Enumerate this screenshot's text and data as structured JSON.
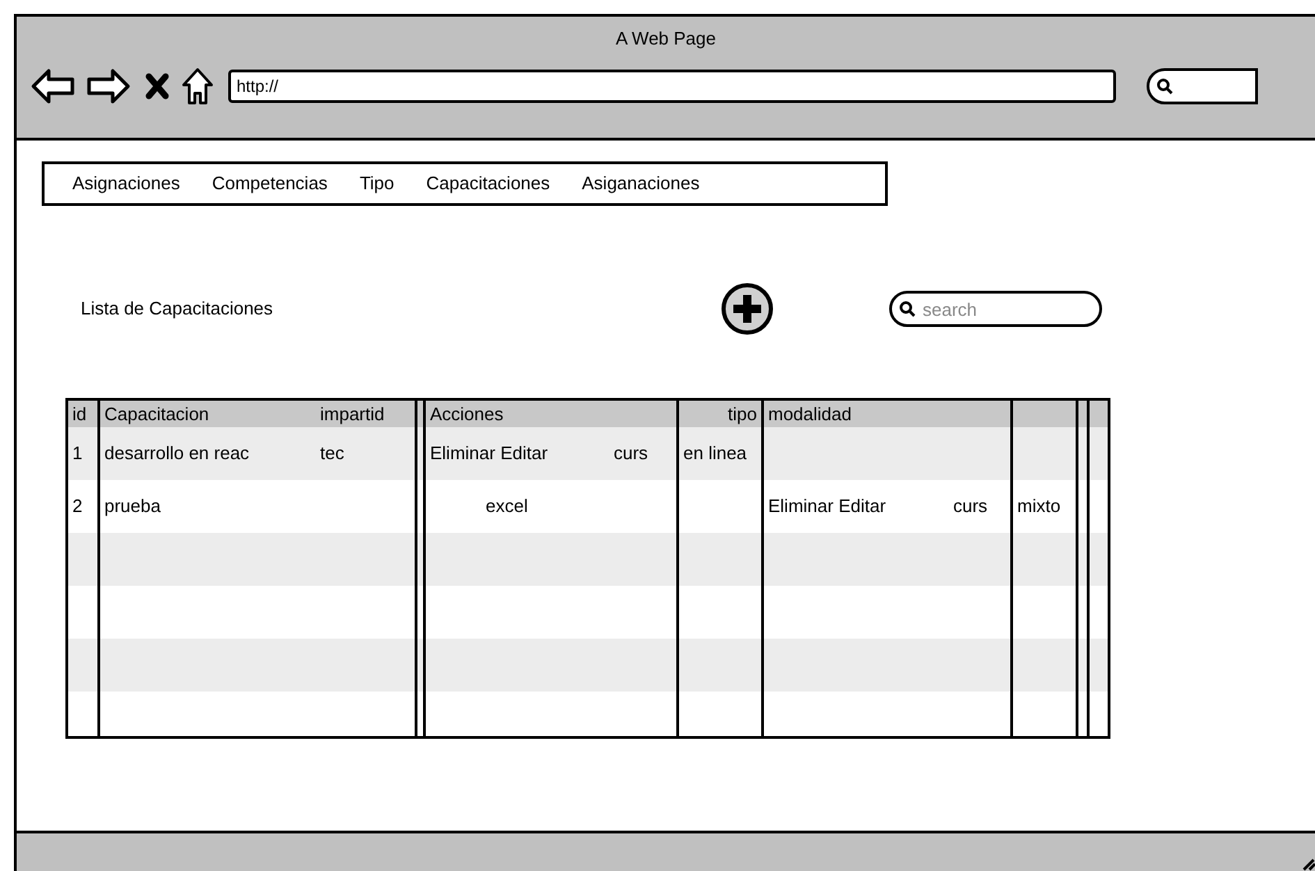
{
  "window": {
    "title": "A Web Page",
    "address": "http://"
  },
  "nav": {
    "items": [
      "Asignaciones",
      "Competencias",
      "Tipo",
      "Capacitaciones",
      "Asiganaciones"
    ]
  },
  "page": {
    "title": "Lista de Capacitaciones",
    "search": {
      "placeholder": "search"
    }
  },
  "table": {
    "columns": [
      "id",
      "Capacitacion",
      "impartid",
      "Acciones",
      "tipo",
      "modalidad"
    ],
    "rows": [
      {
        "id": "1",
        "capacitacion": "desarrollo en reac",
        "impartido": "tec",
        "acciones": "Eliminar Editar",
        "column_7": "curs",
        "tipo": "en linea"
      },
      {
        "id": "2",
        "capacitacion": "prueba",
        "column_6": "excel",
        "modalidad": "Eliminar Editar",
        "column_10": "curs",
        "column_11": "mixto"
      }
    ]
  }
}
